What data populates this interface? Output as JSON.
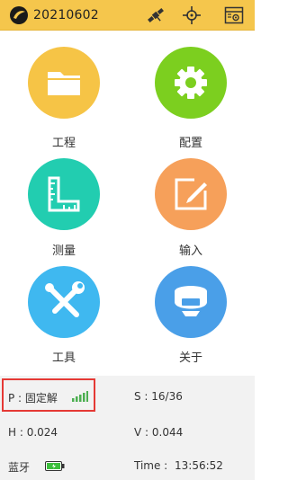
{
  "header": {
    "title": "20210602",
    "icons": [
      "logo-icon",
      "satellite-icon",
      "crosshair-icon",
      "settings-window-icon"
    ]
  },
  "menu": {
    "items": [
      {
        "label": "工程",
        "icon": "folder-icon",
        "color": "#f6c446"
      },
      {
        "label": "配置",
        "icon": "gear-icon",
        "color": "#7ccf1f"
      },
      {
        "label": "测量",
        "icon": "ruler-icon",
        "color": "#22cdb0"
      },
      {
        "label": "输入",
        "icon": "edit-icon",
        "color": "#f6a05a"
      },
      {
        "label": "工具",
        "icon": "tools-icon",
        "color": "#3fb8f0"
      },
      {
        "label": "关于",
        "icon": "receiver-icon",
        "color": "#4a9fe8"
      }
    ]
  },
  "status": {
    "p_label": "P : 固定解",
    "s_label": "S : 16/36",
    "h_label": "H : 0.024",
    "v_label": "V : 0.044",
    "bluetooth_label": "蓝牙",
    "time_label": "Time :",
    "time_value": "13:56:52"
  },
  "colors": {
    "header_bg": "#f5c64c",
    "status_bg": "#f2f2f2",
    "signal": "#4caf50",
    "battery": "#3dbf3d",
    "highlight": "#e53935"
  }
}
